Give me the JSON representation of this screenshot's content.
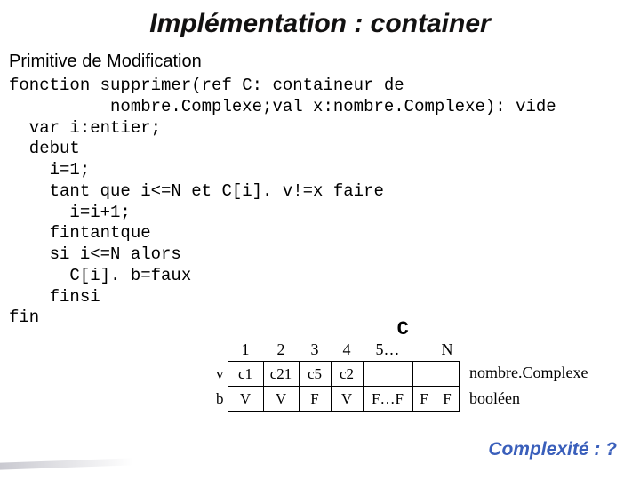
{
  "title": "Implémentation : container",
  "subtitle": "Primitive de Modification",
  "code": {
    "l1": "fonction supprimer(ref C: containeur de",
    "l2": "          nombre.Complexe;val x:nombre.Complexe): vide",
    "l3": "  var i:entier;",
    "l4": "  debut",
    "l5": "    i=1;",
    "l6": "    tant que i<=N et C[i]. v!=x faire",
    "l7": "      i=i+1;",
    "l8": "    fintantque",
    "l9": "    si i<=N alors",
    "l10": "      C[i]. b=faux",
    "l11": "    finsi",
    "l12": "fin"
  },
  "diagram": {
    "heading": "C",
    "indices": [
      "1",
      "2",
      "3",
      "4",
      "5…",
      "",
      "N"
    ],
    "row_v_label": "v",
    "row_b_label": "b",
    "row_v": [
      "c1",
      "c21",
      "c5",
      "c2",
      "",
      "",
      ""
    ],
    "row_b": [
      "V",
      "V",
      "F",
      "V",
      "F…F",
      "F",
      "F"
    ],
    "caption_v": "nombre.Complexe",
    "caption_b": "booléen"
  },
  "complexity": "Complexité : ?",
  "chart_data": {
    "type": "table",
    "title": "C",
    "columns": [
      "1",
      "2",
      "3",
      "4",
      "5…",
      "",
      "N"
    ],
    "rows": [
      {
        "label": "v",
        "cells": [
          "c1",
          "c21",
          "c5",
          "c2",
          "",
          "",
          ""
        ],
        "caption": "nombre.Complexe"
      },
      {
        "label": "b",
        "cells": [
          "V",
          "V",
          "F",
          "V",
          "F…F",
          "F",
          "F"
        ],
        "caption": "booléen"
      }
    ]
  }
}
